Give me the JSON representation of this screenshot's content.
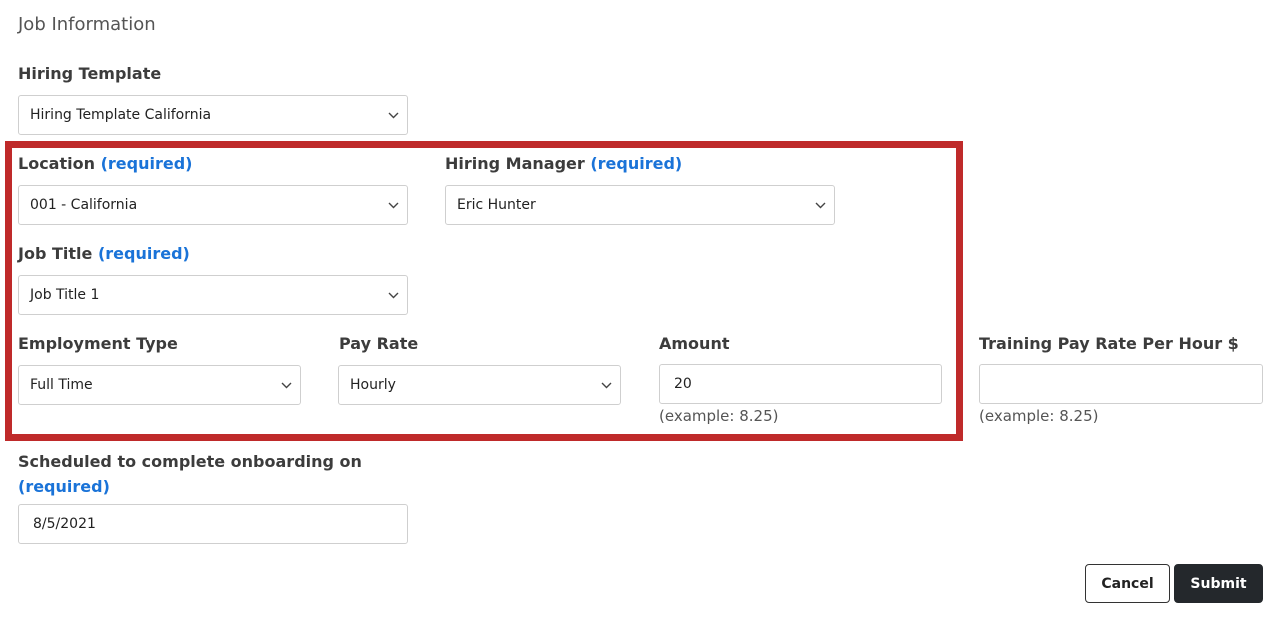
{
  "section_title": "Job Information",
  "required_text": "(required)",
  "hiring_template": {
    "label": "Hiring Template",
    "value": "Hiring Template California"
  },
  "location": {
    "label": "Location",
    "value": "001 - California"
  },
  "hiring_manager": {
    "label": "Hiring Manager",
    "value": "Eric Hunter"
  },
  "job_title": {
    "label": "Job Title",
    "value": "Job Title 1"
  },
  "employment_type": {
    "label": "Employment Type",
    "value": "Full Time"
  },
  "pay_rate": {
    "label": "Pay Rate",
    "value": "Hourly"
  },
  "amount": {
    "label": "Amount",
    "value": "20",
    "hint": "(example: 8.25)"
  },
  "training_pay_rate": {
    "label": "Training Pay Rate Per Hour $",
    "value": "",
    "hint": "(example: 8.25)"
  },
  "scheduled": {
    "label": "Scheduled to complete onboarding on",
    "value": "8/5/2021"
  },
  "buttons": {
    "cancel": "Cancel",
    "submit": "Submit"
  },
  "colors": {
    "required": "#1a73d8",
    "highlight_border": "#bf2a2a",
    "submit_bg": "#24282c"
  },
  "icons": {
    "dropdown": "chevron-down-icon"
  }
}
